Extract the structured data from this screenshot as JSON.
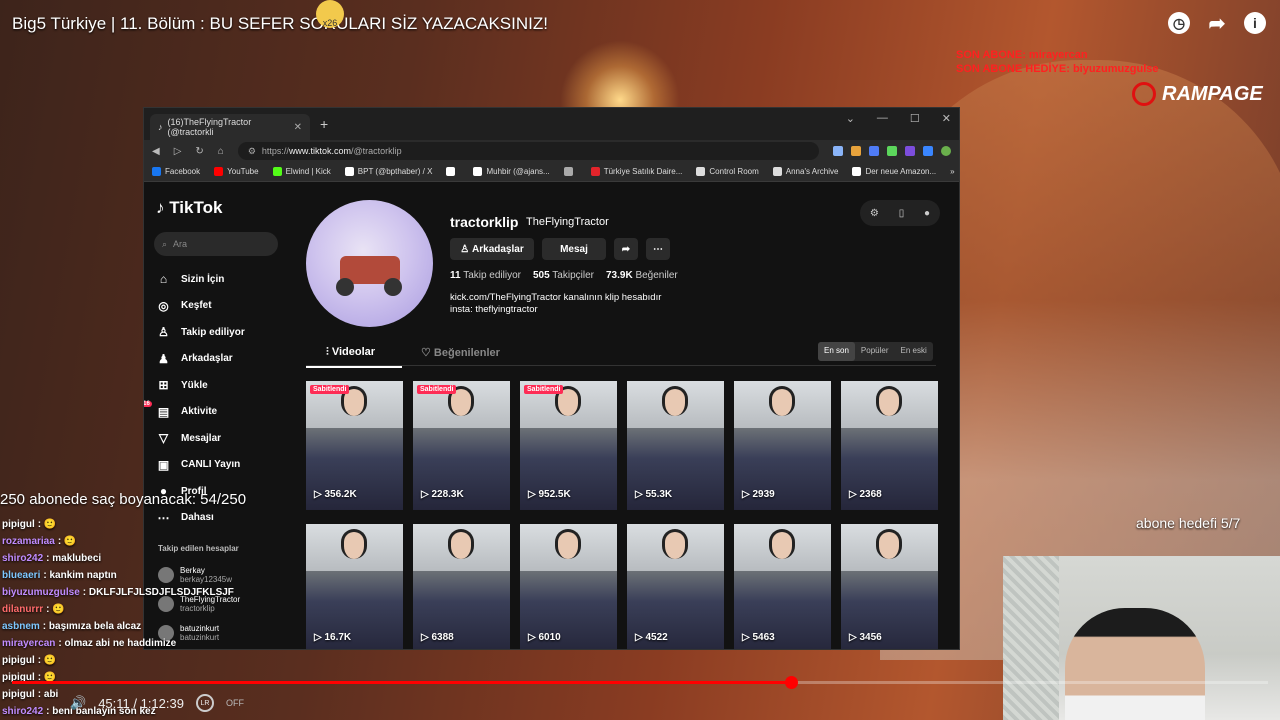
{
  "video": {
    "title": "Big5 Türkiye | 11. Bölüm : BU SEFER SORULARI SİZ YAZACAKSINIZ!",
    "emoji_badge": "x26",
    "time": "45:11 / 1:12:39",
    "progress": 0.62,
    "lr_label": "LR",
    "off_label": "OFF"
  },
  "overlay": {
    "son_abone": "SON ABONE: mirayercan",
    "son_abone_hediye": "SON ABONE HEDİYE: biyuzumuzgulse",
    "rampage": "RAMPAGE",
    "goal": "250 abonede saç boyanacak: 54/250",
    "abone_hedefi": "abone hedefi 5/7"
  },
  "chat": [
    {
      "user": "pipigul",
      "msg": ": 🙂",
      "color": "#ffffff"
    },
    {
      "user": "rozamariaa",
      "msg": ": 🙂",
      "color": "#c08cff"
    },
    {
      "user": "shiro242",
      "msg": ": maklubeci",
      "color": "#c08cff"
    },
    {
      "user": "blueaeri",
      "msg": ": kankim naptın",
      "color": "#7ec8ff"
    },
    {
      "user": "biyuzumuzgulse",
      "msg": ": DKLFJLFJLSDJFLSDJFKLSJF",
      "color": "#c08cff"
    },
    {
      "user": "dilanurrr",
      "msg": ": 🙂",
      "color": "#ff6b6b"
    },
    {
      "user": "asbnem",
      "msg": ": başımıza bela alcaz",
      "color": "#7ec8ff"
    },
    {
      "user": "mirayercan",
      "msg": ": olmaz abi ne haddimize",
      "color": "#c08cff"
    },
    {
      "user": "pipigul",
      "msg": ": 🙂",
      "color": "#ffffff"
    },
    {
      "user": "pipigul",
      "msg": ": 🙂",
      "color": "#ffffff"
    },
    {
      "user": "pipigul",
      "msg": ": abi",
      "color": "#ffffff"
    },
    {
      "user": "shiro242",
      "msg": ": beni banlayın son kez",
      "color": "#c08cff"
    }
  ],
  "browser": {
    "tab_title": "(16)TheFlyingTractor (@tractorkli",
    "url_prefix": "https://",
    "url_domain": "www.tiktok.com",
    "url_path": "/@tractorklip",
    "bookmarks": [
      {
        "label": "Facebook",
        "color": "#1877f2"
      },
      {
        "label": "YouTube",
        "color": "#ff0000"
      },
      {
        "label": "Elwind | Kick",
        "color": "#53fc18"
      },
      {
        "label": "BPT (@bpthaber) / X",
        "color": "#ffffff"
      },
      {
        "label": "",
        "color": "#ffffff"
      },
      {
        "label": "Muhbir (@ajans...",
        "color": "#ffffff"
      },
      {
        "label": "",
        "color": "#aaaaaa"
      },
      {
        "label": "Türkiye Satılık Daire...",
        "color": "#e3242b"
      },
      {
        "label": "Control Room",
        "color": "#dddddd"
      },
      {
        "label": "Anna's Archive",
        "color": "#dddddd"
      },
      {
        "label": "Der neue Amazon...",
        "color": "#ffffff"
      }
    ],
    "more_bookmarks": "»"
  },
  "tiktok": {
    "logo": "TikTok",
    "search_placeholder": "Ara",
    "nav": [
      {
        "label": "Sizin İçin",
        "icon": "⌂"
      },
      {
        "label": "Keşfet",
        "icon": "◎"
      },
      {
        "label": "Takip ediliyor",
        "icon": "♙"
      },
      {
        "label": "Arkadaşlar",
        "icon": "♟"
      },
      {
        "label": "Yükle",
        "icon": "⊞"
      },
      {
        "label": "Aktivite",
        "icon": "▤"
      },
      {
        "label": "Mesajlar",
        "icon": "▽"
      },
      {
        "label": "CANLI Yayın",
        "icon": "▣"
      },
      {
        "label": "Profil",
        "icon": "●"
      },
      {
        "label": "Dahası",
        "icon": "⋯"
      }
    ],
    "activity_badge": "16",
    "followed_title": "Takip edilen hesaplar",
    "followed": [
      {
        "name": "Berkay",
        "handle": "berkay12345w"
      },
      {
        "name": "TheFlyingTractor",
        "handle": "tractorklip"
      },
      {
        "name": "batuzinkurt",
        "handle": "batuzinkurt"
      }
    ],
    "profile": {
      "username": "tractorklip",
      "display_name": "TheFlyingTractor",
      "friends_button": "Arkadaşlar",
      "message_button": "Mesaj",
      "following_count": "11",
      "following_label": "Takip ediliyor",
      "followers_count": "505",
      "followers_label": "Takipçiler",
      "likes_count": "73.9K",
      "likes_label": "Beğeniler",
      "bio_line1": "kick.com/TheFlyingTractor kanalının klip hesabıdır",
      "bio_line2": "insta: theflyingtractor"
    },
    "tabs": {
      "videos": "Videolar",
      "liked": "Beğenilenler"
    },
    "sort": [
      "En son",
      "Popüler",
      "En eski"
    ],
    "pinned_label": "Sabitlendi",
    "videos": [
      {
        "views": "356.2K",
        "pinned": true
      },
      {
        "views": "228.3K",
        "pinned": true
      },
      {
        "views": "952.5K",
        "pinned": true
      },
      {
        "views": "55.3K",
        "pinned": false
      },
      {
        "views": "2939",
        "pinned": false
      },
      {
        "views": "2368",
        "pinned": false
      },
      {
        "views": "16.7K",
        "pinned": false
      },
      {
        "views": "6388",
        "pinned": false
      },
      {
        "views": "6010",
        "pinned": false
      },
      {
        "views": "4522",
        "pinned": false
      },
      {
        "views": "5463",
        "pinned": false
      },
      {
        "views": "3456",
        "pinned": false
      }
    ]
  }
}
